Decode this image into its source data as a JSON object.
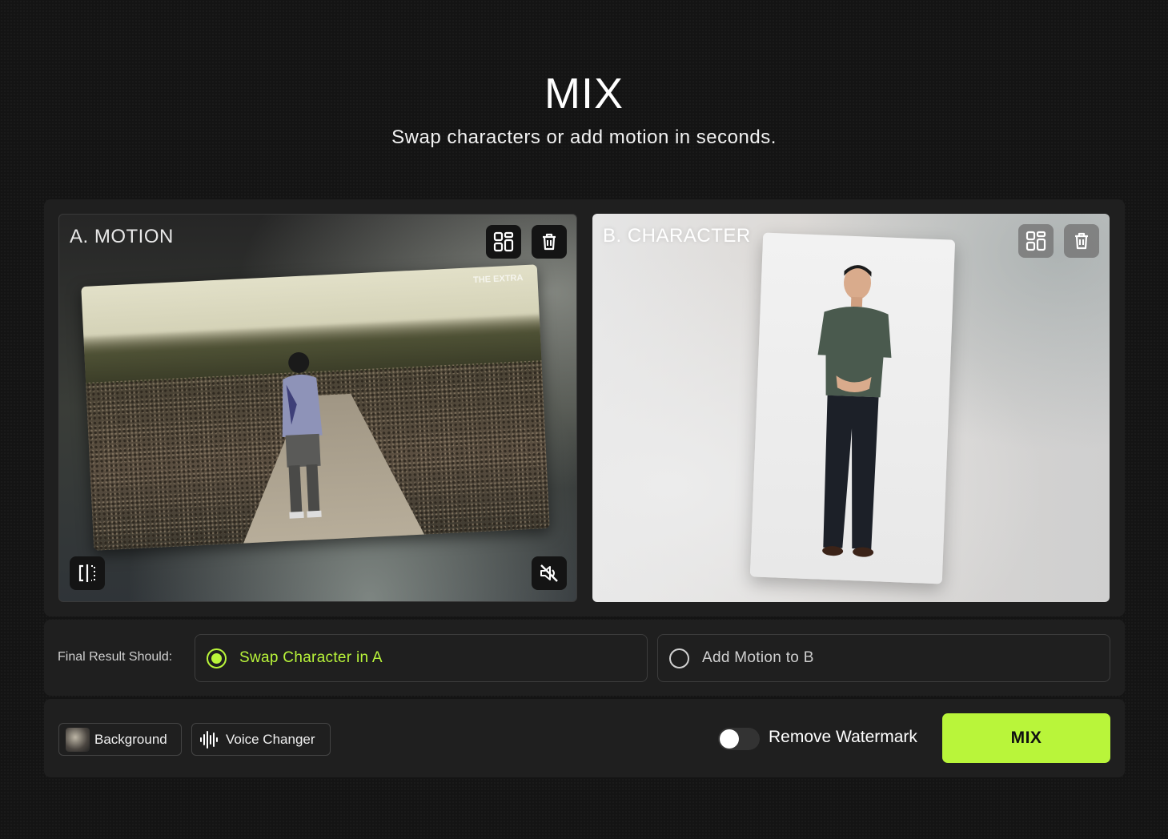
{
  "header": {
    "title": "MIX",
    "subtitle": "Swap characters or add motion in seconds."
  },
  "card_a": {
    "label": "A. MOTION",
    "watermark": "THE EXTRA",
    "icons": [
      "layout-icon",
      "trash-icon",
      "compare-icon",
      "mute-icon"
    ]
  },
  "card_b": {
    "label": "B. CHARACTER",
    "icons": [
      "layout-icon",
      "trash-icon"
    ]
  },
  "options": {
    "label": "Final Result Should:",
    "items": [
      {
        "label": "Swap Character in A",
        "selected": true
      },
      {
        "label": "Add Motion to B",
        "selected": false
      }
    ]
  },
  "bottom": {
    "background_label": "Background",
    "voice_label": "Voice Changer",
    "watermark_toggle_label": "Remove Watermark",
    "watermark_toggle_on": false,
    "mix_button": "MIX"
  },
  "colors": {
    "accent": "#b9f53a",
    "panel": "#1f1f1f",
    "page_bg": "#141414"
  }
}
